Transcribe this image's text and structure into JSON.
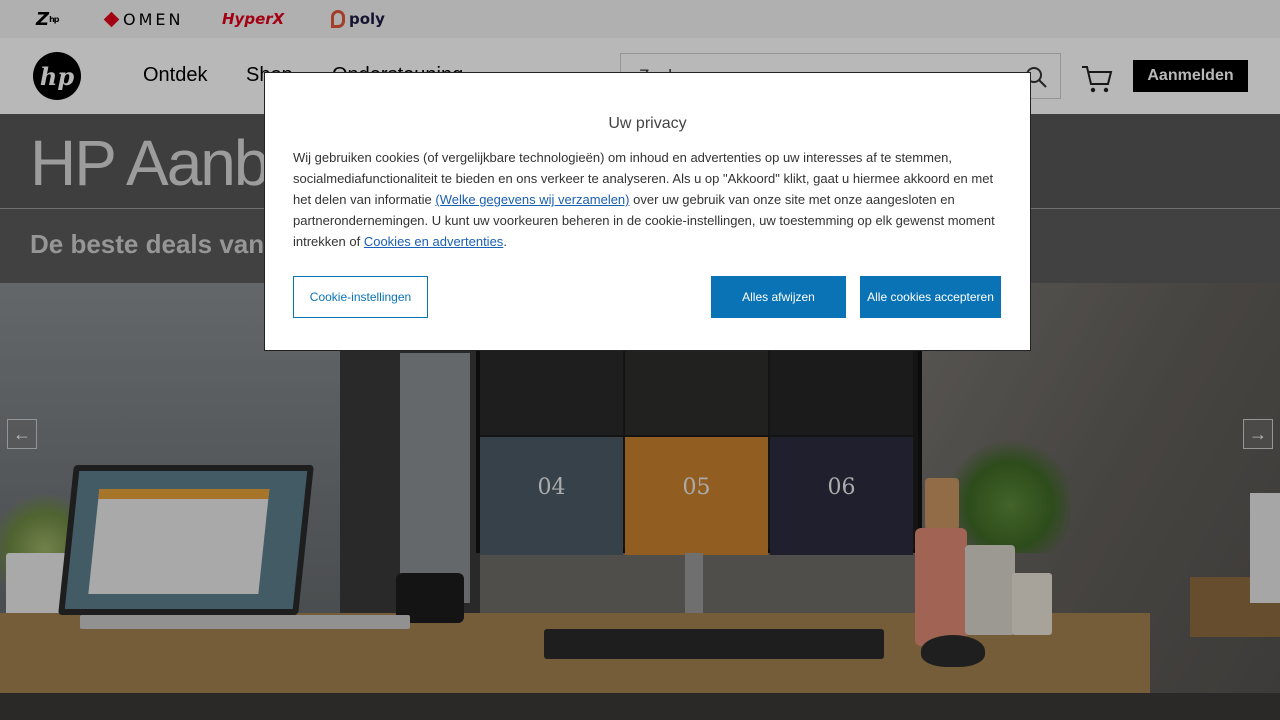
{
  "brands": {
    "z": "Z",
    "omen": "OMEN",
    "hyperx": "HyperX",
    "poly": "poly"
  },
  "header": {
    "logo_text": "hp",
    "nav": [
      "Ontdek",
      "Shop",
      "Ondersteuning"
    ],
    "search_placeholder": "Zoeken",
    "signin_label": "Aanmelden"
  },
  "hero": {
    "title": "HP Aanbiedingen",
    "subtitle": "De beste deals van HP",
    "monitor_tiles": [
      "04",
      "05",
      "06"
    ]
  },
  "privacy_modal": {
    "title": "Uw privacy",
    "text_1": "Wij gebruiken cookies (of vergelijkbare technologieën) om inhoud en advertenties op uw interesses af te stemmen, socialmediafunctionaliteit te bieden en ons verkeer te analyseren. Als u op \"Akkoord\" klikt, gaat u hiermee akkoord en met het delen van informatie ",
    "link_1": "(Welke gegevens wij verzamelen)",
    "text_2": " over uw gebruik van onze site met onze aangesloten en partnerondernemingen. U kunt uw voorkeuren beheren in de cookie-instellingen, uw toestemming op elk gewenst moment intrekken of ",
    "link_2": "Cookies en advertenties",
    "text_3": ".",
    "btn_settings": "Cookie-instellingen",
    "btn_reject": "Alles afwijzen",
    "btn_accept": "Alle cookies accepteren"
  },
  "colors": {
    "accent": "#0a73b5",
    "omen_red": "#e3001b",
    "poly_orange": "#e2563a"
  }
}
